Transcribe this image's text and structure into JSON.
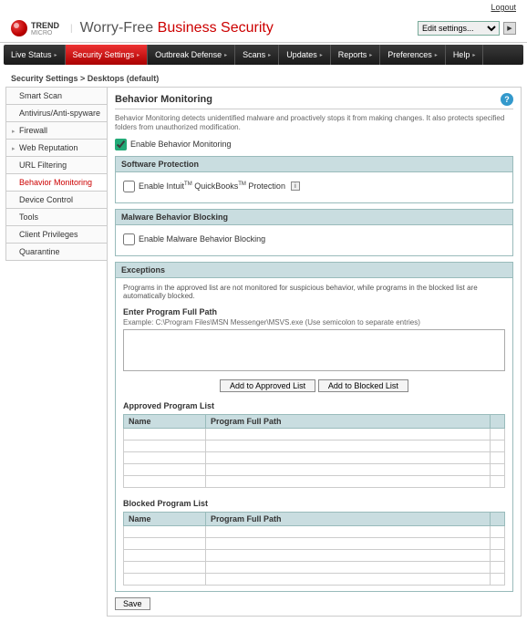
{
  "topbar": {
    "logout": "Logout"
  },
  "header": {
    "brand": "TREND",
    "brand_sub": "MICRO",
    "title_grey": "Worry-Free",
    "title_red": "Business Security",
    "edit_label": "Edit settings..."
  },
  "nav": {
    "items": [
      {
        "label": "Live Status"
      },
      {
        "label": "Security Settings",
        "active": true
      },
      {
        "label": "Outbreak Defense"
      },
      {
        "label": "Scans"
      },
      {
        "label": "Updates"
      },
      {
        "label": "Reports"
      },
      {
        "label": "Preferences"
      },
      {
        "label": "Help"
      }
    ]
  },
  "breadcrumb": "Security Settings > Desktops (default)",
  "sidebar": {
    "items": [
      {
        "label": "Smart Scan"
      },
      {
        "label": "Antivirus/Anti-spyware"
      },
      {
        "label": "Firewall",
        "caret": true
      },
      {
        "label": "Web Reputation",
        "caret": true
      },
      {
        "label": "URL Filtering"
      },
      {
        "label": "Behavior Monitoring",
        "active": true
      },
      {
        "label": "Device Control"
      },
      {
        "label": "Tools"
      },
      {
        "label": "Client Privileges"
      },
      {
        "label": "Quarantine"
      }
    ]
  },
  "main": {
    "title": "Behavior Monitoring",
    "desc": "Behavior Monitoring detects unidentified malware and proactively stops it from making changes. It also protects specified folders from unauthorized modification.",
    "enable_label": "Enable Behavior Monitoring",
    "software": {
      "head": "Software Protection",
      "opt_pre": "Enable Intuit",
      "opt_mid": " QuickBooks",
      "opt_post": " Protection"
    },
    "malware": {
      "head": "Malware Behavior Blocking",
      "opt": "Enable Malware Behavior Blocking"
    },
    "exceptions": {
      "head": "Exceptions",
      "desc": "Programs in the approved list are not monitored for suspicious behavior, while programs in the blocked list are automatically blocked.",
      "field_label": "Enter Program Full Path",
      "example": "Example: C:\\Program Files\\MSN Messenger\\MSVS.exe (Use semicolon to separate entries)",
      "btn_approve": "Add to Approved List",
      "btn_block": "Add to Blocked List",
      "approved_label": "Approved Program List",
      "blocked_label": "Blocked Program List",
      "col_name": "Name",
      "col_path": "Program Full Path"
    },
    "save": "Save"
  }
}
